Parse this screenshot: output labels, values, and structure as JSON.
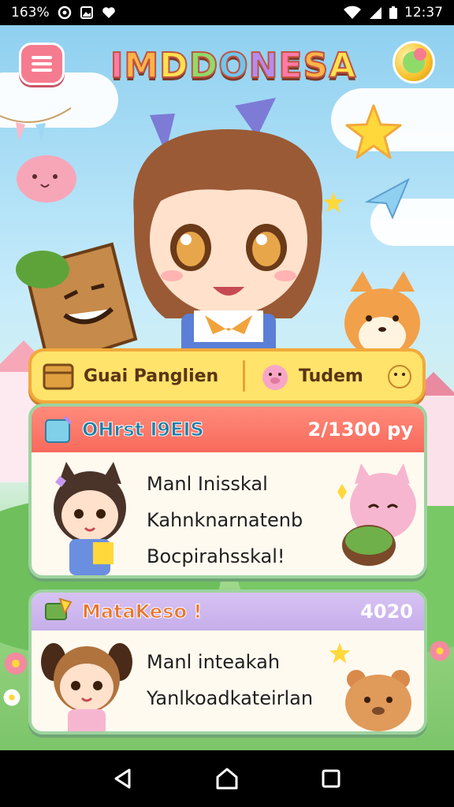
{
  "status_bar": {
    "left_text": "163%",
    "time": "12:37",
    "icons": [
      "circle-status-icon",
      "image-status-icon",
      "heart-status-icon",
      "wifi-icon",
      "signal-icon",
      "battery-icon"
    ]
  },
  "header": {
    "title": "IMDDONESA",
    "menu_icon": "menu-icon",
    "orb_icon": "orb-icon"
  },
  "tabs": [
    {
      "label": "Guai Panglien",
      "icon": "crate-icon"
    },
    {
      "label": "Tudem",
      "icon": "pig-icon"
    }
  ],
  "cards": [
    {
      "title": "OHrst I9EIS",
      "meta": "2/1300 py",
      "lines": [
        "Manl Inisskal",
        "Kahnknarnatenb",
        "Bocpirahsskal!"
      ]
    },
    {
      "title": "MataKeso !",
      "meta": "4020",
      "lines": [
        "Manl inteakah",
        "Yanlkoadkateirlan"
      ]
    }
  ],
  "colors": {
    "accent": "#ffe36b",
    "card_border": "#9ed3a0",
    "card1_header": "#f86a5c",
    "card2_header": "#c6aeea"
  },
  "nav": {
    "back": "back-icon",
    "home": "home-icon",
    "recents": "recents-icon"
  }
}
